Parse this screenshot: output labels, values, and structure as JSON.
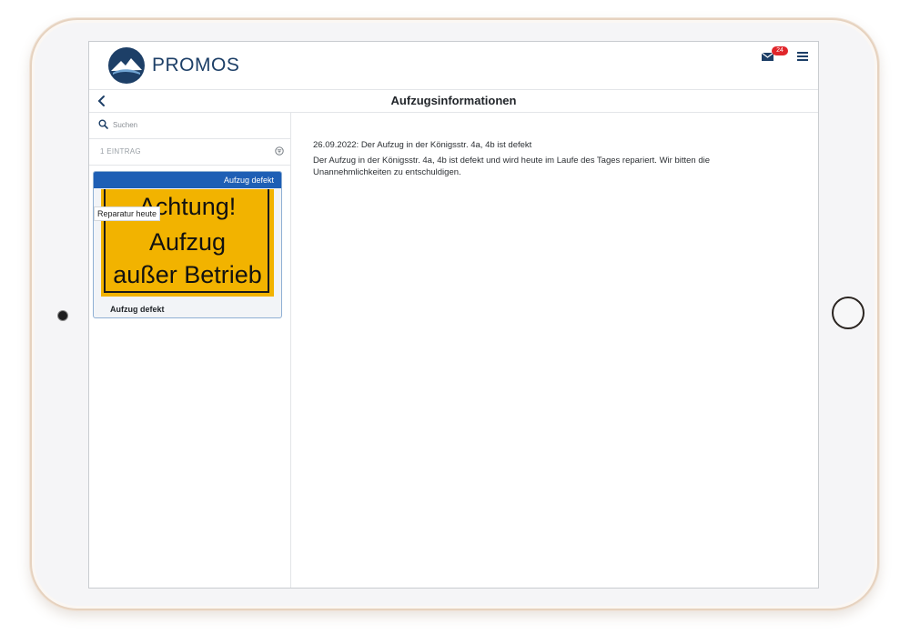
{
  "app": {
    "brand": "PROMOS",
    "mail_badge": "24",
    "icons": {
      "logo": "mountain-logo-icon",
      "mail": "mail-icon",
      "menu": "hamburger-menu-icon",
      "back": "chevron-left-icon",
      "search": "search-icon",
      "filter": "filter-circle-icon"
    },
    "colors": {
      "brand": "#1d3f67",
      "status_bar": "#1e5fb5",
      "badge": "#e0262b",
      "sign": "#f2b300"
    }
  },
  "page": {
    "title": "Aufzugsinformationen"
  },
  "sidebar": {
    "search_placeholder": "Suchen",
    "count_label": "1 EINTRAG",
    "cards": [
      {
        "status": "Aufzug defekt",
        "tooltip": "Reparatur heute",
        "image_text": [
          "Achtung!",
          "Aufzug",
          "außer Betrieb"
        ],
        "title": "Aufzug defekt"
      }
    ]
  },
  "content": {
    "heading": "26.09.2022: Der Aufzug in der Königsstr. 4a, 4b ist defekt",
    "body": "Der Aufzug in der Königsstr. 4a, 4b ist defekt und wird heute im Laufe des Tages repariert. Wir bitten die Unannehmlichkeiten zu entschuldigen."
  }
}
